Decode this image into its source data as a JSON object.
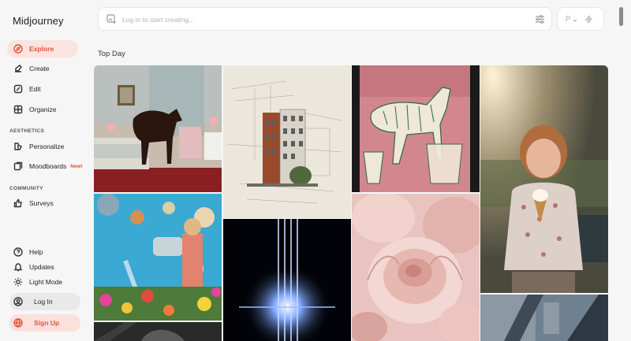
{
  "app": {
    "name": "Midjourney"
  },
  "nav": {
    "items": [
      {
        "label": "Explore",
        "icon": "compass-icon",
        "active": true
      },
      {
        "label": "Create",
        "icon": "brush-icon"
      },
      {
        "label": "Edit",
        "icon": "edit-icon"
      },
      {
        "label": "Organize",
        "icon": "grid-icon"
      }
    ],
    "aesthetics_label": "AESTHETICS",
    "aesthetics": [
      {
        "label": "Personalize",
        "icon": "personalize-icon"
      },
      {
        "label": "Moodboards",
        "icon": "moodboard-icon",
        "badge": "New!"
      }
    ],
    "community_label": "COMMUNITY",
    "community": [
      {
        "label": "Surveys",
        "icon": "thumbs-up-icon"
      }
    ],
    "bottom": [
      {
        "label": "Help",
        "icon": "help-icon"
      },
      {
        "label": "Updates",
        "icon": "bell-icon"
      },
      {
        "label": "Light Mode",
        "icon": "sun-icon"
      }
    ],
    "login_label": "Log In",
    "signup_label": "Sign Up"
  },
  "search": {
    "placeholder": "Log in to start creating..."
  },
  "mode": {
    "letter": "P"
  },
  "section_title": "Top Day",
  "colors": {
    "accent": "#e2543a",
    "accent_bg": "#fbe3df",
    "background": "#f6f6f6"
  },
  "gallery": [
    {
      "name": "horse-bedroom-image"
    },
    {
      "name": "architecture-sketch-image"
    },
    {
      "name": "zebra-pattern-image"
    },
    {
      "name": "girl-icecream-image"
    },
    {
      "name": "collage-watering-can-image"
    },
    {
      "name": "light-flare-image"
    },
    {
      "name": "pink-peony-image"
    },
    {
      "name": "motion-blur-image"
    },
    {
      "name": "dark-portrait-image"
    }
  ]
}
